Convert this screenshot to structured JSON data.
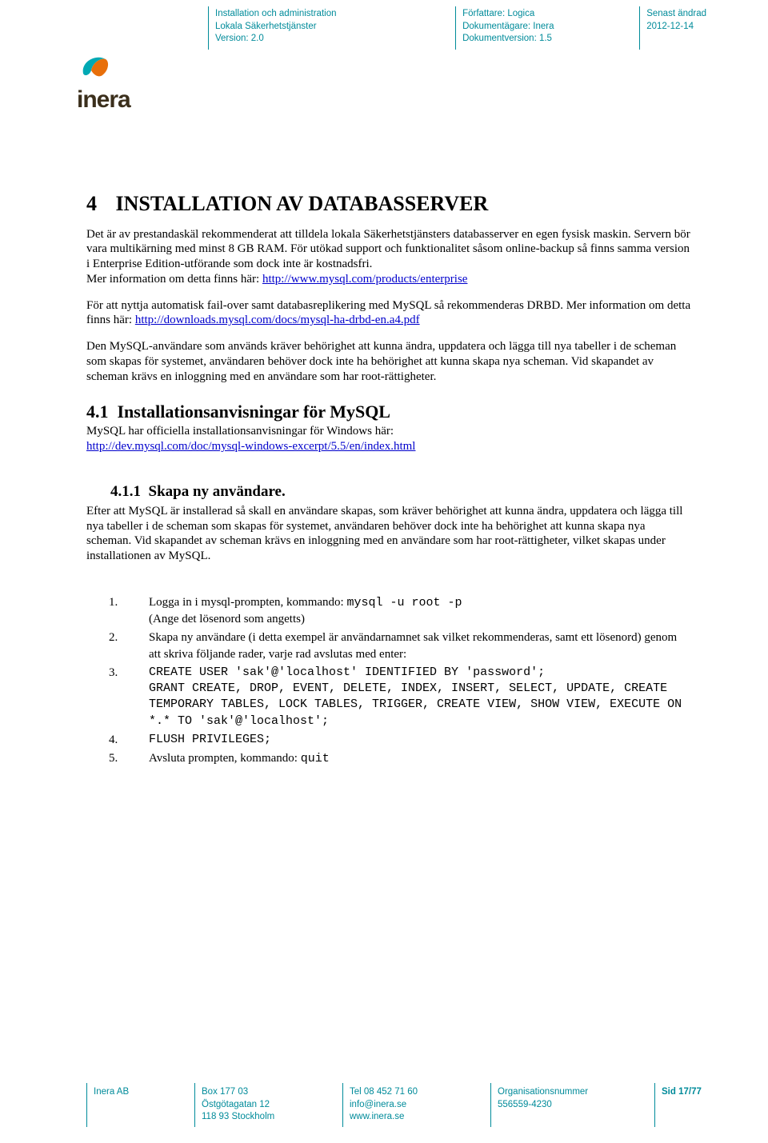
{
  "header": {
    "col1": {
      "l1": "Installation och administration",
      "l2": "Lokala Säkerhetstjänster",
      "l3": "Version: 2.0"
    },
    "col2": {
      "l1": "Författare: Logica",
      "l2": "Dokumentägare: Inera",
      "l3": "Dokumentversion: 1.5"
    },
    "col3": {
      "l1": "Senast ändrad",
      "l2": "2012-12-14"
    }
  },
  "logo_text": "inera",
  "section4": {
    "number": "4",
    "title": "INSTALLATION AV DATABASSERVER",
    "para1_a": "Det är av prestandaskäl rekommenderat att tilldela lokala Säkerhetstjänsters databasserver en egen fysisk maskin. Servern bör vara multikärning med minst 8 GB RAM. För utökad support och funktionalitet såsom online-backup så finns samma version i Enterprise Edition-utförande som dock inte är kostnadsfri.",
    "para1_b": "Mer information om detta finns här: ",
    "link1": "http://www.mysql.com/products/enterprise",
    "para2_a": "För att nyttja automatisk fail-over samt databasreplikering med MySQL så rekommenderas DRBD. Mer information om detta finns här: ",
    "link2": "http://downloads.mysql.com/docs/mysql-ha-drbd-en.a4.pdf",
    "para3": "Den MySQL-användare som används kräver behörighet att kunna ändra, uppdatera och lägga till nya tabeller i de scheman som skapas för systemet, användaren behöver dock inte ha behörighet att kunna skapa nya scheman. Vid skapandet av scheman krävs en inloggning med en användare som har root-rättigheter."
  },
  "section41": {
    "number": "4.1",
    "title": "Installationsanvisningar för MySQL",
    "text": "MySQL har officiella installationsanvisningar för Windows här:",
    "link": "http://dev.mysql.com/doc/mysql-windows-excerpt/5.5/en/index.html"
  },
  "section411": {
    "number": "4.1.1",
    "title": "Skapa ny användare.",
    "text": "Efter att MySQL är installerad så skall en användare skapas, som kräver behörighet att kunna ändra, uppdatera och lägga till nya tabeller i de scheman som skapas för systemet, användaren behöver dock inte ha behörighet att kunna skapa nya scheman. Vid skapandet av scheman krävs en inloggning med en användare som har root-rättigheter, vilket skapas under installationen av MySQL."
  },
  "steps": {
    "s1": {
      "num": "1.",
      "text_a": "Logga in i mysql-prompten, kommando: ",
      "code": "mysql -u root -p",
      "text_b": "(Ange det lösenord som angetts)"
    },
    "s2": {
      "num": "2.",
      "text": "Skapa ny användare (i detta exempel är användarnamnet sak vilket rekommenderas, samt ett lösenord) genom att skriva följande rader, varje rad avslutas med enter:"
    },
    "s3": {
      "num": "3.",
      "code": "CREATE USER 'sak'@'localhost' IDENTIFIED BY 'password';\nGRANT CREATE, DROP, EVENT, DELETE, INDEX, INSERT, SELECT, UPDATE, CREATE TEMPORARY TABLES, LOCK TABLES, TRIGGER, CREATE VIEW, SHOW VIEW, EXECUTE ON *.* TO 'sak'@'localhost';"
    },
    "s4": {
      "num": "4.",
      "code": "FLUSH PRIVILEGES;"
    },
    "s5": {
      "num": "5.",
      "text_a": "Avsluta prompten, kommando: ",
      "code": "quit"
    }
  },
  "footer": {
    "c1": {
      "l1": "Inera AB"
    },
    "c2": {
      "l1": "Box 177 03",
      "l2": "Östgötagatan 12",
      "l3": "118 93 Stockholm"
    },
    "c3": {
      "l1": "Tel 08 452 71 60",
      "l2": "info@inera.se",
      "l3": "www.inera.se"
    },
    "c4": {
      "l1": "Organisationsnummer",
      "l2": "556559-4230"
    },
    "c5": {
      "l1": "Sid 17/77"
    }
  }
}
